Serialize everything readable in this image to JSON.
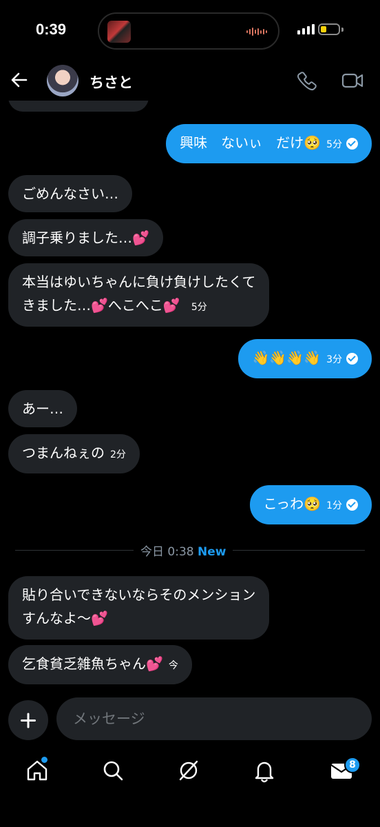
{
  "status_bar": {
    "time": "0:39"
  },
  "header": {
    "contact_name": "ちさと"
  },
  "messages": [
    {
      "dir": "out",
      "text": "興味　ないぃ　だけ🥺",
      "time": "5分"
    },
    {
      "dir": "in",
      "text": "ごめんなさい…"
    },
    {
      "dir": "in",
      "text": "調子乗りました…💕"
    },
    {
      "dir": "in",
      "line1": "本当はゆいちゃんに負け負けしたくて",
      "line2": "きました…💕へこへこ💕",
      "time": "5分"
    },
    {
      "dir": "out",
      "text": "👋👋👋👋",
      "time": "3分"
    },
    {
      "dir": "in",
      "text": "あー…"
    },
    {
      "dir": "in",
      "text": "つまんねぇの",
      "time": "2分"
    },
    {
      "dir": "out",
      "text": "こっわ🥺",
      "time": "1分"
    },
    {
      "dir": "in",
      "line1": "貼り合いできないならそのメンション",
      "line2": "すんなよ〜💕"
    },
    {
      "dir": "in",
      "text": "乞食貧乏雑魚ちゃん💕",
      "time": "今"
    }
  ],
  "divider": {
    "label": "今日 0:38",
    "new": "New"
  },
  "composer": {
    "placeholder": "メッセージ"
  },
  "tabbar": {
    "messages_badge": "8"
  },
  "colors": {
    "accent": "#1d9bf0",
    "incoming_bubble": "#202327",
    "background": "#000000"
  },
  "icons": [
    "back-arrow-icon",
    "phone-icon",
    "video-icon",
    "plus-icon",
    "home-icon",
    "search-icon",
    "grok-icon",
    "bell-icon",
    "mail-icon"
  ]
}
